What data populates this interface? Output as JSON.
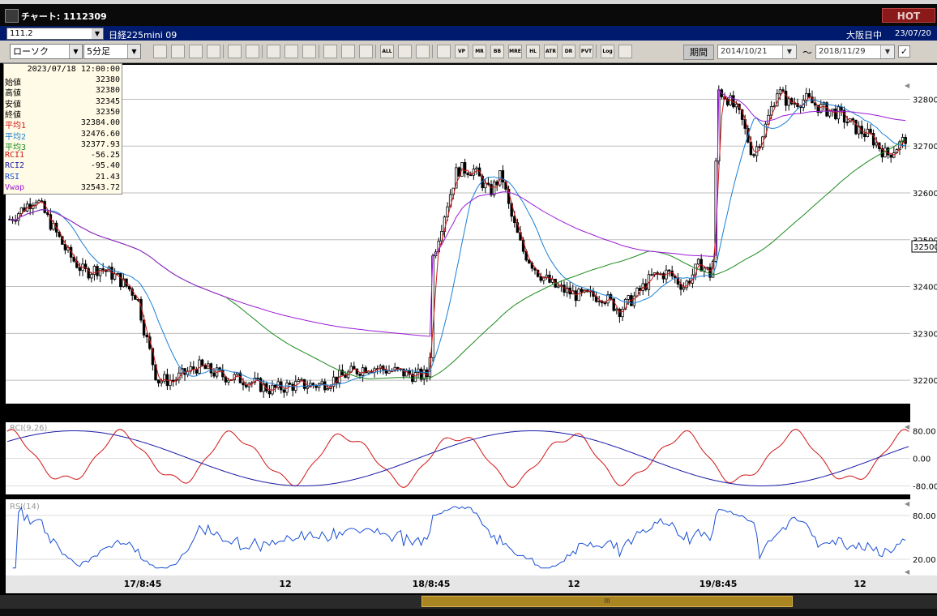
{
  "window": {
    "title": "チャート: 1112309",
    "hot_label": "HOT"
  },
  "symbol_bar": {
    "code": "111.2",
    "name": "日経225mini 09",
    "market": "大阪日中",
    "date": "23/07/20"
  },
  "toolbar": {
    "chart_type": "ローソク",
    "interval": "5分足",
    "buttons": [
      "zoom",
      "cross",
      "study",
      "book",
      "candle",
      "misc",
      "pen",
      "cursor",
      "undo",
      "move",
      "extend",
      "redo",
      "all",
      "gear",
      "tool",
      "color",
      "vp",
      "mr",
      "bb",
      "mre",
      "hl",
      "atr",
      "drr",
      "pvt",
      "log",
      "print"
    ],
    "button_labels": {
      "bb": "BB",
      "hl": "HL",
      "atr": "ATR",
      "all": "ALL",
      "log": "Log",
      "pvt": "PVT",
      "mr": "MR",
      "mre": "MRE",
      "vp": "VP",
      "drr": "DR RR"
    },
    "period_label": "期間",
    "date_from": "2014/10/21",
    "date_to": "2018/11/29",
    "tilde": "〜",
    "check": "✓"
  },
  "info_box": {
    "datetime": "2023/07/18 12:00:00",
    "rows": [
      {
        "label": "始値",
        "value": "32380",
        "color": "#000000"
      },
      {
        "label": "高値",
        "value": "32380",
        "color": "#000000"
      },
      {
        "label": "安値",
        "value": "32345",
        "color": "#000000"
      },
      {
        "label": "終値",
        "value": "32350",
        "color": "#000000"
      },
      {
        "label": "平均1",
        "value": "32384.00",
        "color": "#d11515"
      },
      {
        "label": "平均2",
        "value": "32476.60",
        "color": "#1a7fd6"
      },
      {
        "label": "平均3",
        "value": "32377.93",
        "color": "#1c8a1c"
      },
      {
        "label": "RCI1",
        "value": "-56.25",
        "color": "#d11515"
      },
      {
        "label": "RCI2",
        "value": "-95.40",
        "color": "#1a1aa8"
      },
      {
        "label": "RSI",
        "value": "21.43",
        "color": "#1a4fd6"
      },
      {
        "label": "Vwap",
        "value": "32543.72",
        "color": "#9a1ad6"
      }
    ]
  },
  "chart_data": [
    {
      "type": "line",
      "panel": "price",
      "ylim": [
        32150,
        32870
      ],
      "y_ticks": [
        32200,
        32300,
        32400,
        32500,
        32600,
        32700,
        32800
      ],
      "y_tick_labels": [
        "32200",
        "32300",
        "32400",
        "32500",
        "32600",
        "32700",
        "32800"
      ],
      "current_price_label": "32500",
      "series": [
        {
          "name": "平均1",
          "color": "#d11515"
        },
        {
          "name": "平均2",
          "color": "#1a7fd6"
        },
        {
          "name": "平均3",
          "color": "#1c8a1c"
        },
        {
          "name": "Vwap",
          "color": "#9a1ad6"
        }
      ],
      "candles": "candlestick OHLC series (5-minute bars)"
    },
    {
      "type": "line",
      "panel": "rci",
      "ylim": [
        -100,
        100
      ],
      "y_tick_labels": [
        "80.00",
        "0.00",
        "-80.00"
      ],
      "title": "RCI(9,26)",
      "series": [
        {
          "name": "RCI1",
          "color": "#d11515"
        },
        {
          "name": "RCI2",
          "color": "#1a1aa8"
        }
      ]
    },
    {
      "type": "line",
      "panel": "rsi",
      "ylim": [
        0,
        100
      ],
      "y_tick_labels": [
        "80.00",
        "20.00"
      ],
      "title": "RSI(14)",
      "series": [
        {
          "name": "RSI",
          "color": "#1a4fd6"
        }
      ]
    }
  ],
  "x_axis": {
    "labels": [
      "17/8:45",
      "12",
      "18/8:45",
      "12",
      "19/8:45",
      "12"
    ]
  }
}
